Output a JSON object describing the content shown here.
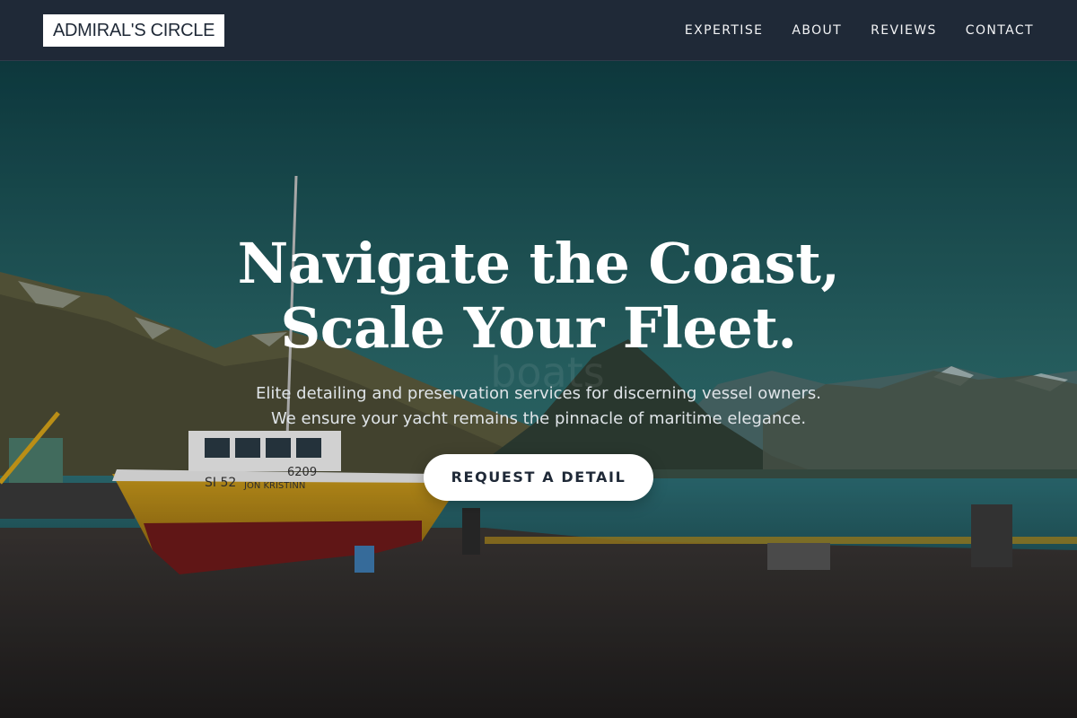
{
  "header": {
    "logo_text": "ADMIRAL'S CIRCLE",
    "nav": [
      {
        "label": "EXPERTISE"
      },
      {
        "label": "ABOUT"
      },
      {
        "label": "REVIEWS"
      },
      {
        "label": "CONTACT"
      }
    ]
  },
  "hero": {
    "headline_line1": "Navigate the Coast,",
    "headline_line2": "Scale Your Fleet.",
    "subtitle_line1": "Elite detailing and preservation services for discerning vessel owners.",
    "subtitle_line2": "We ensure your yacht remains the pinnacle of maritime elegance.",
    "cta_label": "REQUEST A DETAIL",
    "watermark": "boats",
    "boat_hull_number": "6209",
    "boat_registration": "SI 52",
    "boat_name": "JON KRISTINN"
  },
  "colors": {
    "header_bg": "#1f2937",
    "button_bg": "#ffffff",
    "button_text": "#1f2937",
    "headline": "#ffffff",
    "sky_teal": "#2e6a6b",
    "hull_yellow": "#c99a1c",
    "hull_red": "#6e1a1a"
  }
}
